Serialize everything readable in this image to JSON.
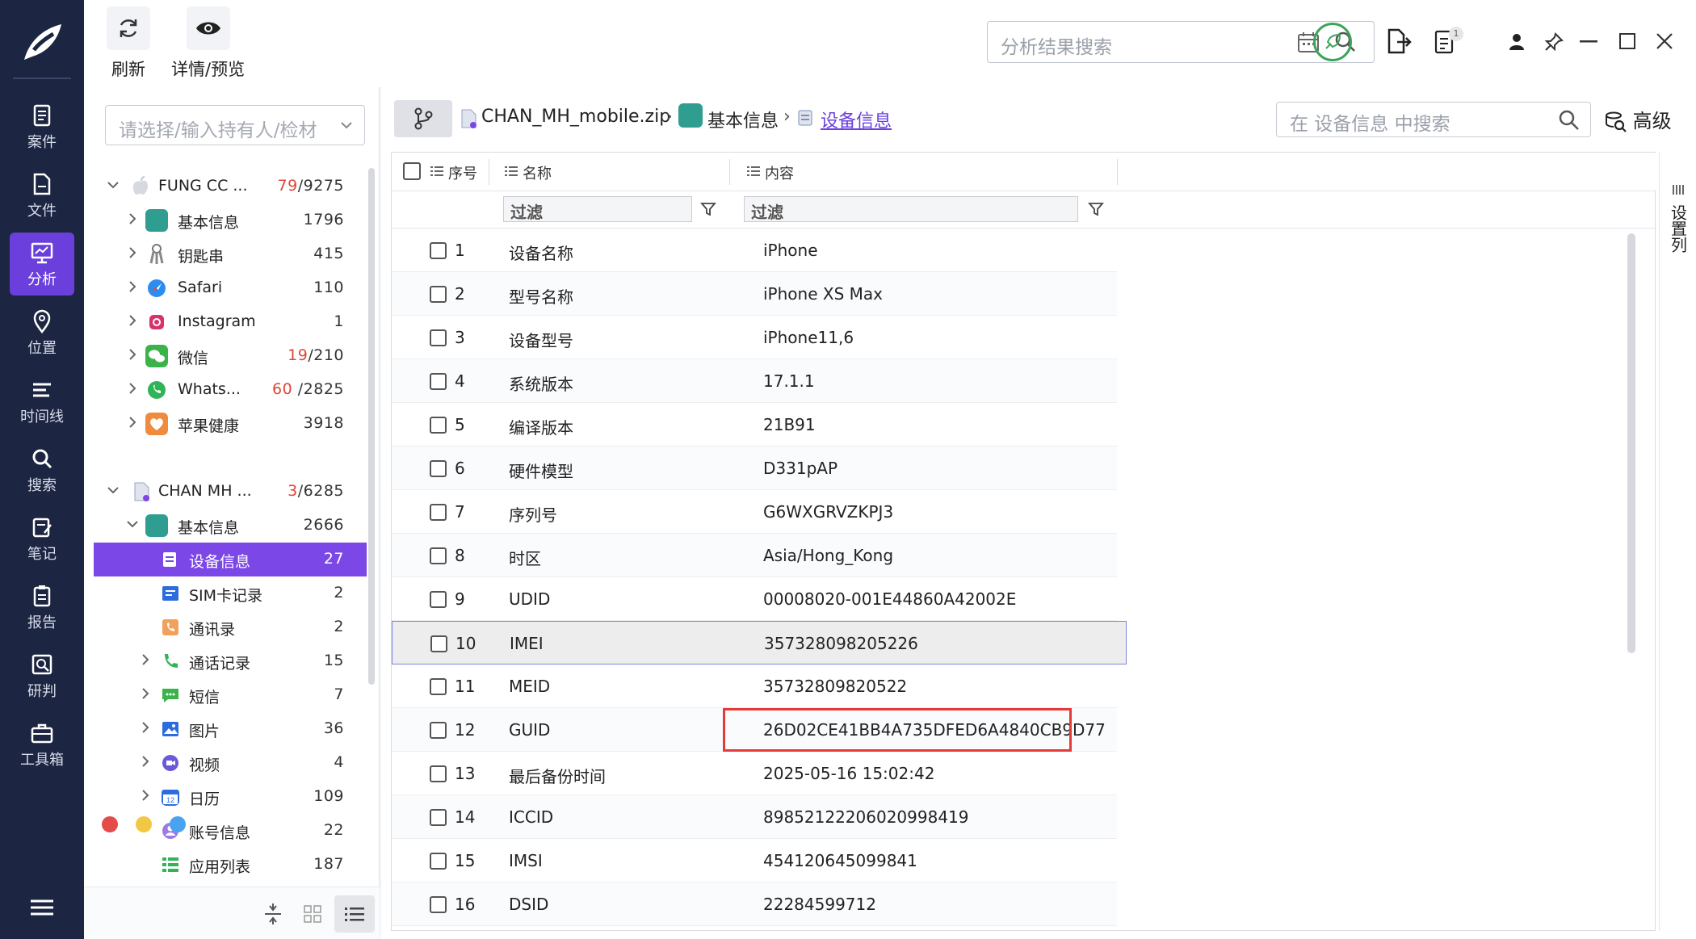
{
  "toolbar": {
    "refresh_label": "刷新",
    "preview_label": "详情/预览",
    "search_placeholder": "分析结果搜索",
    "badge_count": "1"
  },
  "nav": {
    "items": [
      {
        "label": "案件",
        "icon": "case-icon"
      },
      {
        "label": "文件",
        "icon": "file-icon"
      },
      {
        "label": "分析",
        "icon": "analysis-icon",
        "active": true
      },
      {
        "label": "位置",
        "icon": "location-icon"
      },
      {
        "label": "时间线",
        "icon": "timeline-icon"
      },
      {
        "label": "搜索",
        "icon": "search-icon"
      },
      {
        "label": "笔记",
        "icon": "notes-icon"
      },
      {
        "label": "报告",
        "icon": "report-icon"
      },
      {
        "label": "研判",
        "icon": "judge-icon"
      },
      {
        "label": "工具箱",
        "icon": "toolbox-icon"
      }
    ]
  },
  "tree": {
    "owner_placeholder": "请选择/输入持有人/检材",
    "sources": [
      {
        "name": "FUNG CC ...",
        "count_hl": "79",
        "count_total": "/9275",
        "items": [
          {
            "label": "基本信息",
            "count": "1796",
            "icon": "info-icon"
          },
          {
            "label": "钥匙串",
            "count": "415",
            "icon": "keychain-icon"
          },
          {
            "label": "Safari",
            "count": "110",
            "icon": "safari-icon"
          },
          {
            "label": "Instagram",
            "count": "1",
            "icon": "instagram-icon"
          },
          {
            "label": "微信",
            "count_hl": "19",
            "count": "/210",
            "icon": "wechat-icon"
          },
          {
            "label": "Whats...",
            "count_hl": "60",
            "count": "/2825",
            "icon": "whatsapp-icon"
          },
          {
            "label": "苹果健康",
            "count": "3918",
            "icon": "health-icon"
          }
        ]
      },
      {
        "name": "CHAN MH ...",
        "count_hl": "3",
        "count_total": "/6285",
        "group": {
          "label": "基本信息",
          "count": "2666"
        },
        "items": [
          {
            "label": "设备信息",
            "count": "27",
            "selected": true
          },
          {
            "label": "SIM卡记录",
            "count": "2"
          },
          {
            "label": "通讯录",
            "count": "2"
          },
          {
            "label": "通话记录",
            "count": "15"
          },
          {
            "label": "短信",
            "count": "7"
          },
          {
            "label": "图片",
            "count": "36"
          },
          {
            "label": "视频",
            "count": "4"
          },
          {
            "label": "日历",
            "count": "109"
          },
          {
            "label": "账号信息",
            "count": "22"
          },
          {
            "label": "应用列表",
            "count": "187"
          }
        ]
      }
    ]
  },
  "breadcrumb": {
    "file": "CHAN_MH_mobile.zip",
    "category": "基本信息",
    "current": "设备信息"
  },
  "content_search": {
    "placeholder": "在 设备信息 中搜索",
    "advanced_label": "高级"
  },
  "table": {
    "headers": {
      "index": "序号",
      "name": "名称",
      "content": "内容"
    },
    "filter_placeholder": "过滤",
    "rows": [
      {
        "n": "1",
        "name": "设备名称",
        "value": "iPhone"
      },
      {
        "n": "2",
        "name": "型号名称",
        "value": "iPhone XS Max"
      },
      {
        "n": "3",
        "name": "设备型号",
        "value": "iPhone11,6"
      },
      {
        "n": "4",
        "name": "系统版本",
        "value": "17.1.1"
      },
      {
        "n": "5",
        "name": "编译版本",
        "value": "21B91"
      },
      {
        "n": "6",
        "name": "硬件模型",
        "value": "D331pAP"
      },
      {
        "n": "7",
        "name": "序列号",
        "value": "G6WXGRVZKPJ3"
      },
      {
        "n": "8",
        "name": "时区",
        "value": "Asia/Hong_Kong"
      },
      {
        "n": "9",
        "name": "UDID",
        "value": "00008020-001E44860A42002E"
      },
      {
        "n": "10",
        "name": "IMEI",
        "value": "357328098205226"
      },
      {
        "n": "11",
        "name": "MEID",
        "value": "35732809820522"
      },
      {
        "n": "12",
        "name": "GUID",
        "value": "26D02CE41BB4A735DFED6A4840CB9D77"
      },
      {
        "n": "13",
        "name": "最后备份时间",
        "value": "2025-05-16 15:02:42"
      },
      {
        "n": "14",
        "name": "ICCID",
        "value": "89852122206020998419"
      },
      {
        "n": "15",
        "name": "IMSI",
        "value": "454120645099841"
      },
      {
        "n": "16",
        "name": "DSID",
        "value": "22284599712"
      }
    ],
    "column_settings_label": "设置列"
  }
}
